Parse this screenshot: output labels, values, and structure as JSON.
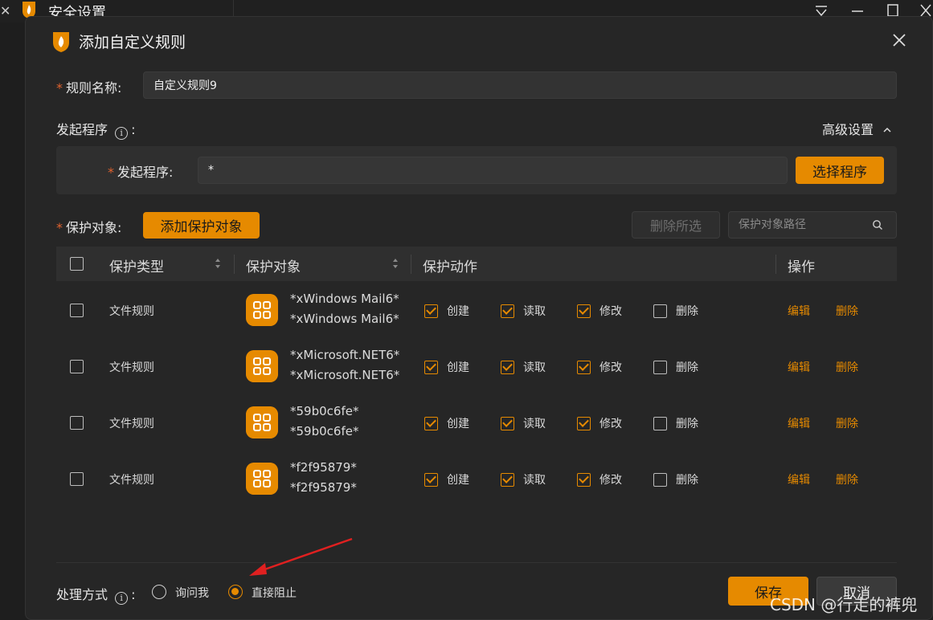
{
  "window": {
    "title": "安全设置"
  },
  "dialog": {
    "title": "添加自定义规则",
    "rule_name_label": "规则名称:",
    "rule_name_value": "自定义规则9",
    "initiator_section_label": "发起程序",
    "advanced_label": "高级设置",
    "initiator_label": "发起程序:",
    "initiator_value": "*",
    "select_program_label": "选择程序",
    "protect_target_label": "保护对象:",
    "add_protect_target_label": "添加保护对象",
    "delete_selected_label": "删除所选",
    "search_placeholder": "保护对象路径",
    "colon": ":"
  },
  "table": {
    "headers": [
      "保护类型",
      "保护对象",
      "保护动作",
      "操作"
    ],
    "rows": [
      {
        "type": "文件规则",
        "obj1": "*xWindows Mail6*",
        "obj2": "*xWindows Mail6*",
        "create": true,
        "read": true,
        "modify": true,
        "delete": false
      },
      {
        "type": "文件规则",
        "obj1": "*xMicrosoft.NET6*",
        "obj2": "*xMicrosoft.NET6*",
        "create": true,
        "read": true,
        "modify": true,
        "delete": false
      },
      {
        "type": "文件规则",
        "obj1": "*59b0c6fe*",
        "obj2": "*59b0c6fe*",
        "create": true,
        "read": true,
        "modify": true,
        "delete": false
      },
      {
        "type": "文件规则",
        "obj1": "*f2f95879*",
        "obj2": "*f2f95879*",
        "create": true,
        "read": true,
        "modify": true,
        "delete": false
      }
    ],
    "actions": {
      "create": "创建",
      "read": "读取",
      "modify": "修改",
      "delete": "删除"
    },
    "ops": {
      "edit": "编辑",
      "delete": "删除"
    }
  },
  "footer": {
    "handling_label": "处理方式",
    "colon": ":",
    "option_ask": "询问我",
    "option_block": "直接阻止",
    "selected": "option_block",
    "save_label": "保存",
    "cancel_label": "取消"
  },
  "watermark": "CSDN @行走的裤兜",
  "colors": {
    "accent": "#e68a00",
    "required": "#e0622e",
    "background": "#262626"
  }
}
